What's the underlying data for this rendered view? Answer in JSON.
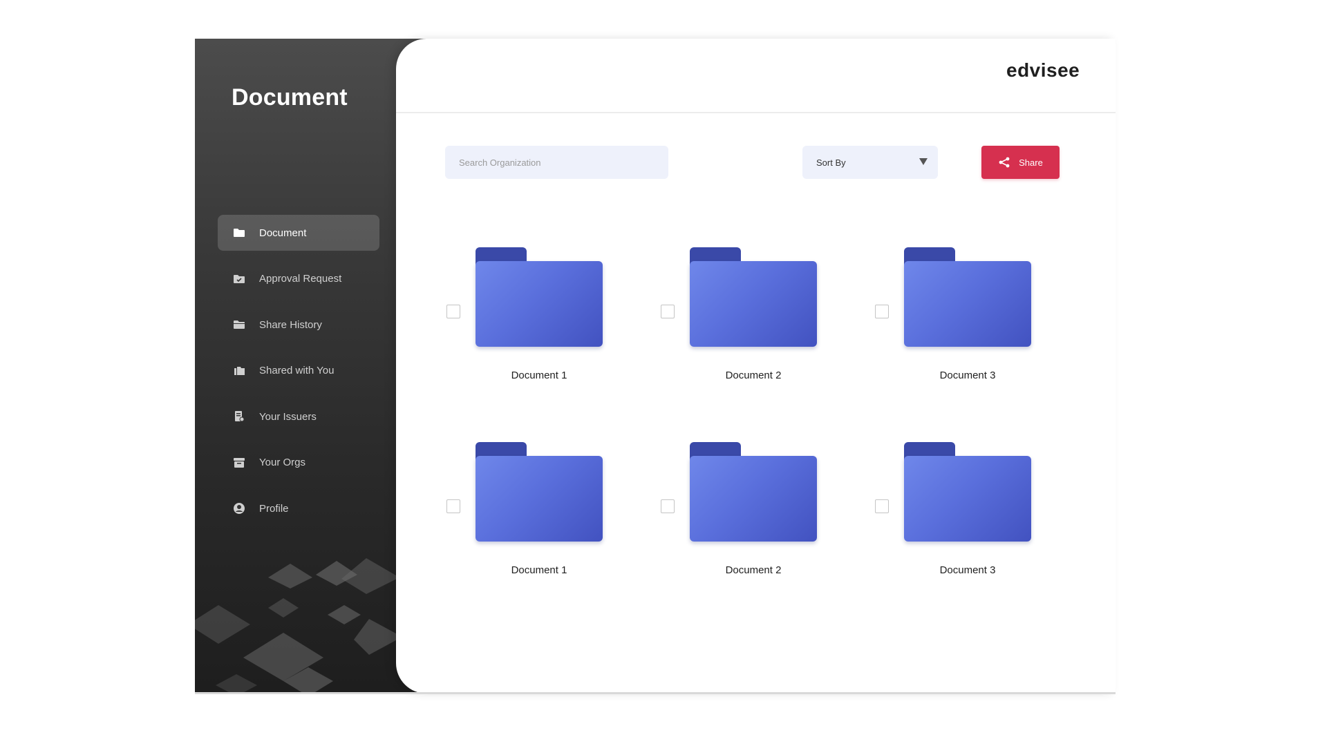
{
  "sidebar": {
    "title": "Document",
    "items": [
      {
        "label": "Document",
        "icon": "folder-icon",
        "active": true
      },
      {
        "label": "Approval Request",
        "icon": "approval-folder-icon",
        "active": false
      },
      {
        "label": "Share History",
        "icon": "open-folder-icon",
        "active": false
      },
      {
        "label": "Shared with You",
        "icon": "shared-files-icon",
        "active": false
      },
      {
        "label": "Your Issuers",
        "icon": "issuer-document-icon",
        "active": false
      },
      {
        "label": "Your Orgs",
        "icon": "archive-box-icon",
        "active": false
      },
      {
        "label": "Profile",
        "icon": "user-circle-icon",
        "active": false
      }
    ]
  },
  "header": {
    "logo": "edvisee"
  },
  "toolbar": {
    "search_placeholder": "Search Organization",
    "search_value": "",
    "sort_label": "Sort By",
    "share_label": "Share"
  },
  "documents": [
    {
      "label": "Document 1",
      "checked": false
    },
    {
      "label": "Document 2",
      "checked": false
    },
    {
      "label": "Document 3",
      "checked": false
    },
    {
      "label": "Document 1",
      "checked": false
    },
    {
      "label": "Document 2",
      "checked": false
    },
    {
      "label": "Document 3",
      "checked": false
    }
  ],
  "colors": {
    "accent": "#d6304f",
    "folder": "#5a6fdc",
    "folder_tab": "#3a49a8",
    "sidebar": "#2f2f2f",
    "input_bg": "#eef1fb"
  }
}
